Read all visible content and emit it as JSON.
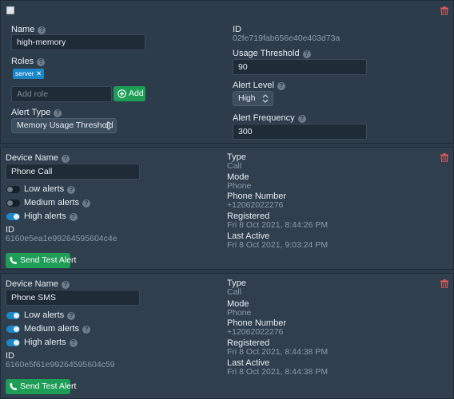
{
  "alert": {
    "name_label": "Name",
    "name_value": "high-memory",
    "roles_label": "Roles",
    "role_tag": "server",
    "add_role_placeholder": "Add role",
    "add_button": "Add",
    "alert_type_label": "Alert Type",
    "alert_type_value": "Memory Usage Threshold",
    "id_label": "ID",
    "id_value": "02fe719fab656e40e403d73a",
    "usage_threshold_label": "Usage Threshold",
    "usage_threshold_value": "90",
    "alert_level_label": "Alert Level",
    "alert_level_value": "High",
    "alert_frequency_label": "Alert Frequency",
    "alert_frequency_value": "300"
  },
  "devices": [
    {
      "device_name_label": "Device Name",
      "device_name_value": "Phone Call",
      "low_alerts_label": "Low alerts",
      "low_alerts_on": false,
      "medium_alerts_label": "Medium alerts",
      "medium_alerts_on": false,
      "high_alerts_label": "High alerts",
      "high_alerts_on": true,
      "id_label": "ID",
      "id_value": "6160e5ea1e99264595604c4e",
      "send_button": "Send Test Alert",
      "type_label": "Type",
      "type_value": "Call",
      "mode_label": "Mode",
      "mode_value": "Phone",
      "phone_label": "Phone Number",
      "phone_value": "+12062022276",
      "registered_label": "Registered",
      "registered_value": "Fri 8 Oct 2021, 8:44:26 PM",
      "last_active_label": "Last Active",
      "last_active_value": "Fri 8 Oct 2021, 9:03:24 PM"
    },
    {
      "device_name_label": "Device Name",
      "device_name_value": "Phone SMS",
      "low_alerts_label": "Low alerts",
      "low_alerts_on": true,
      "medium_alerts_label": "Medium alerts",
      "medium_alerts_on": true,
      "high_alerts_label": "High alerts",
      "high_alerts_on": true,
      "id_label": "ID",
      "id_value": "6160e5f61e99264595604c59",
      "send_button": "Send Test Alert",
      "type_label": "Type",
      "type_value": "Call",
      "mode_label": "Mode",
      "mode_value": "Phone",
      "phone_label": "Phone Number",
      "phone_value": "+12062022276",
      "registered_label": "Registered",
      "registered_value": "Fri 8 Oct 2021, 8:44:38 PM",
      "last_active_label": "Last Active",
      "last_active_value": "Fri 8 Oct 2021, 8:44:38 PM"
    }
  ],
  "icons": {
    "help": "question-circle-icon",
    "delete": "trash-icon",
    "add": "plus-circle-icon",
    "phone": "phone-icon",
    "select": "chevron-up-down-icon"
  },
  "colors": {
    "accent_green": "#1d9d56",
    "accent_blue": "#1b87c8",
    "danger_red": "#e05a5a"
  }
}
